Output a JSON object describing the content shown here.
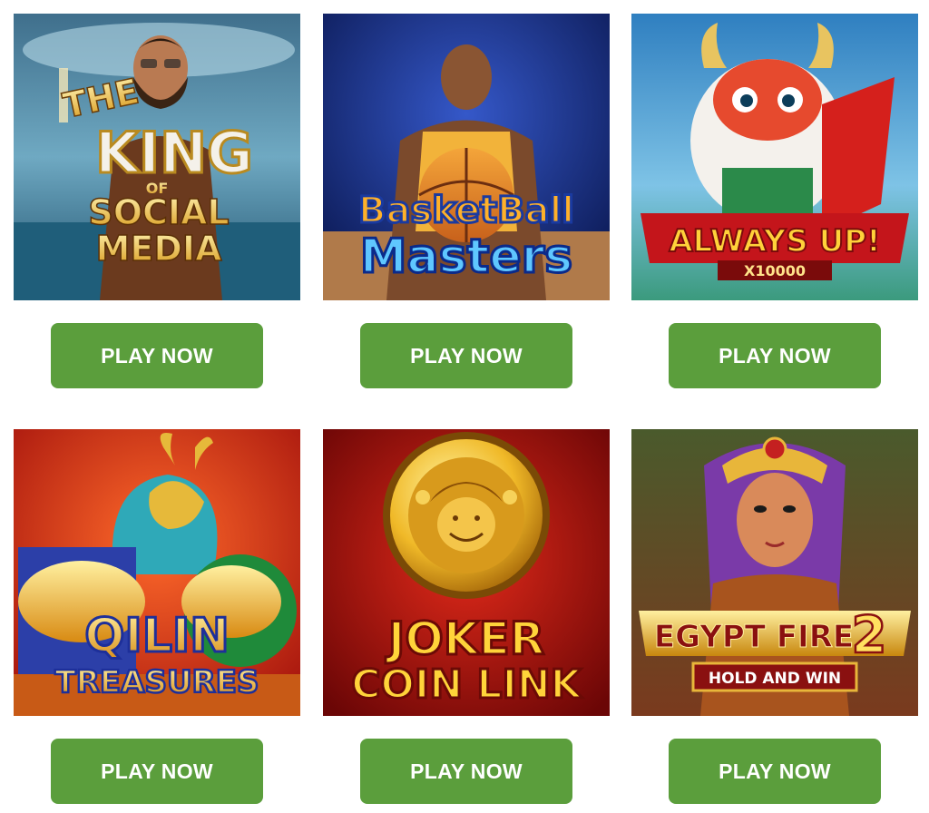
{
  "games": [
    {
      "title_lines": [
        "THE",
        "KING",
        "OF",
        "SOCIAL",
        "MEDIA"
      ],
      "button_label": "PLAY NOW"
    },
    {
      "title_lines": [
        "BasketBall",
        "Masters"
      ],
      "button_label": "PLAY NOW"
    },
    {
      "title_lines": [
        "ALWAYS UP!",
        "X10000"
      ],
      "button_label": "PLAY NOW"
    },
    {
      "title_lines": [
        "QILIN",
        "TREASURES"
      ],
      "button_label": "PLAY NOW"
    },
    {
      "title_lines": [
        "JOKER",
        "COIN LINK"
      ],
      "button_label": "PLAY NOW"
    },
    {
      "title_lines": [
        "EGYPT FIRE",
        "2",
        "HOLD AND WIN"
      ],
      "button_label": "PLAY NOW"
    }
  ],
  "colors": {
    "button_green": "#5b9e3c",
    "button_text": "#ffffff",
    "page_background": "#ffffff"
  }
}
